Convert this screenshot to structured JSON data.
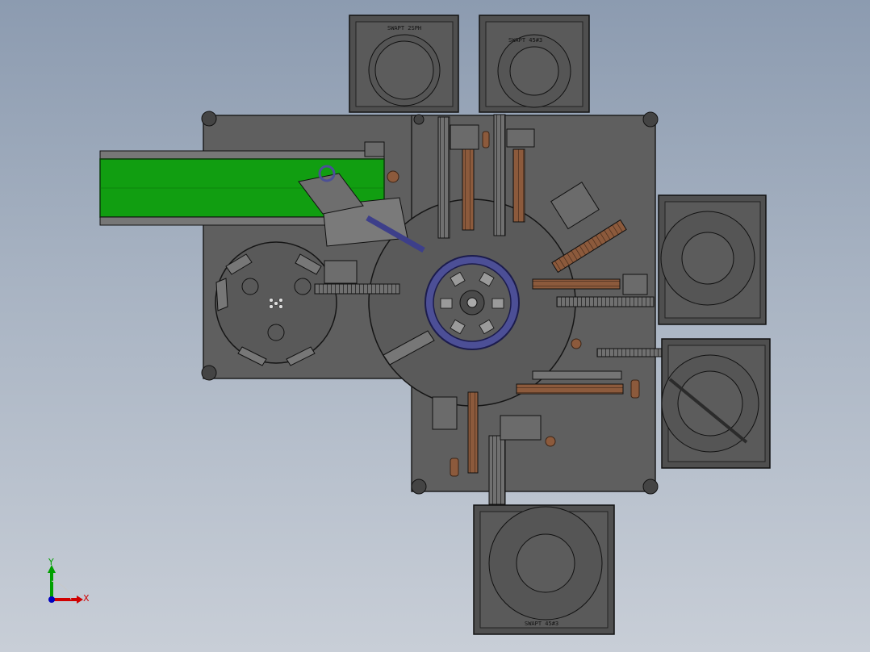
{
  "window": {
    "type": "cad-viewport",
    "view": "top"
  },
  "colors": {
    "plate": "#5f5f5f",
    "plate_edge": "#1e1e1e",
    "conveyor_belt": "#119e11",
    "turntable": "#4c4f96",
    "wood_parts": "#8c5a3c",
    "feeder_bowl_bg": "#555555"
  },
  "feeder_labels": {
    "top_left": "SWAPT 2SPH",
    "top_right": "SWAPT 45#3",
    "bottom": "SWAPT 45#3"
  },
  "triad": {
    "x_label": "X",
    "y_label": "Y",
    "x_color": "#d00000",
    "y_color": "#00a000",
    "z_color": "#0000c0"
  }
}
